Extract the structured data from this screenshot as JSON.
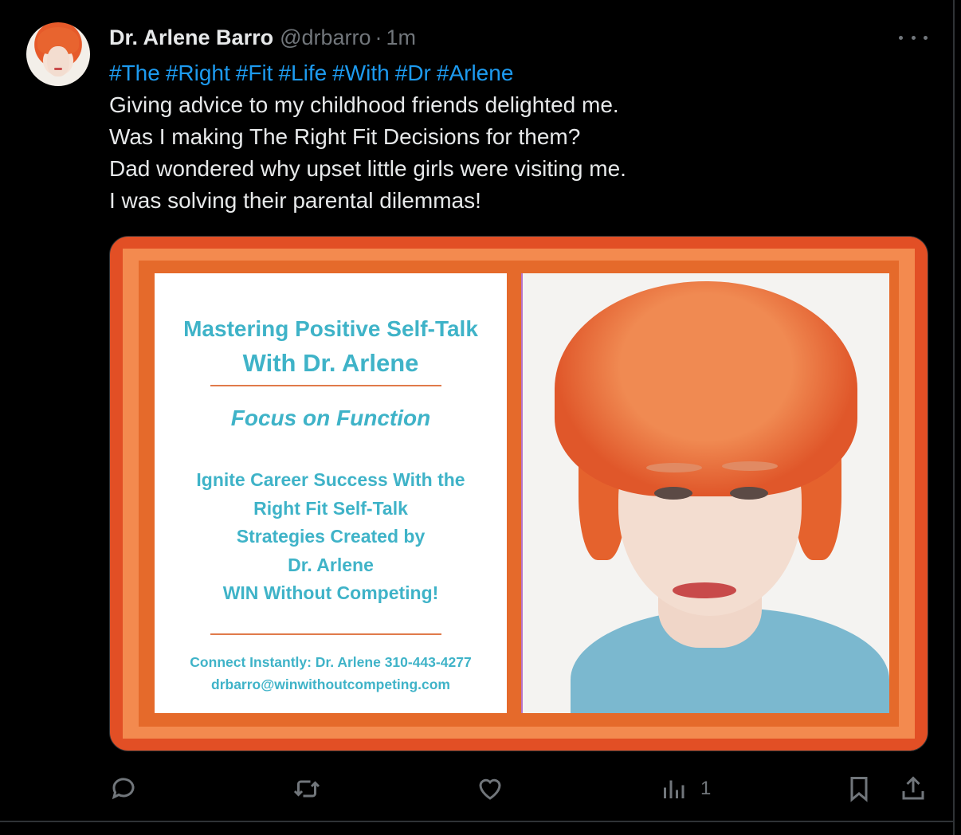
{
  "author": {
    "name": "Dr. Arlene Barro",
    "handle": "@drbarro",
    "separator": "·",
    "time": "1m"
  },
  "hashtags": [
    "#The",
    "#Right",
    "#Fit",
    "#Life",
    "#With",
    "#Dr",
    "#Arlene"
  ],
  "body_lines": [
    "Giving advice to my childhood friends delighted me.",
    "Was I making The Right Fit Decisions for them?",
    "Dad wondered why upset little girls were visiting me.",
    "I was solving their parental dilemmas!"
  ],
  "media_card": {
    "title_line1": "Mastering Positive Self-Talk",
    "title_line2": "With Dr. Arlene",
    "focus": "Focus on Function",
    "body": [
      "Ignite Career Success With the",
      "Right Fit Self-Talk",
      "Strategies Created by",
      "Dr. Arlene",
      "WIN Without Competing!"
    ],
    "contact_line1": "Connect Instantly: Dr. Arlene 310-443-4277",
    "contact_line2": "drbarro@winwithoutcompeting.com",
    "colors": {
      "orange_outer": "#e24f25",
      "orange_mid": "#f38a4f",
      "teal_text": "#3fb3c8"
    }
  },
  "actions": {
    "reply_icon": "reply-icon",
    "retweet_icon": "retweet-icon",
    "like_icon": "heart-icon",
    "views_icon": "views-icon",
    "views_count": "1",
    "bookmark_icon": "bookmark-icon",
    "share_icon": "share-icon"
  },
  "colors": {
    "background": "#000000",
    "text": "#e7e9ea",
    "muted": "#71767b",
    "link": "#1d9bf0"
  }
}
